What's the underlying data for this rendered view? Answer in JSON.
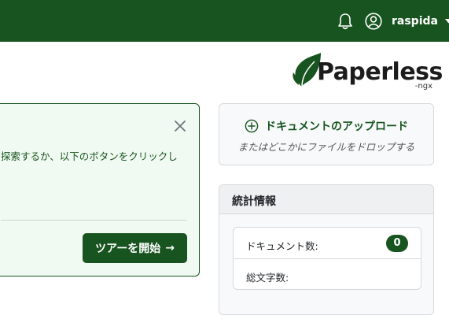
{
  "topbar": {
    "username": "raspida",
    "icons": {
      "notifications": "bell-icon",
      "user": "user-circle-icon",
      "menu": "caret-down-icon"
    }
  },
  "logo": {
    "name": "Paperless",
    "suffix": "-ngx"
  },
  "welcome": {
    "text": "探索するか、以下のボタンをクリックし",
    "tour_button": "ツアーを開始",
    "tour_arrow": "→"
  },
  "upload": {
    "title": "ドキュメントのアップロード",
    "hint": "またはどこかにファイルをドロップする"
  },
  "stats": {
    "title": "統計情報",
    "rows": [
      {
        "label": "ドキュメント数:",
        "value": "0"
      },
      {
        "label": "総文字数:"
      }
    ]
  },
  "colors": {
    "brand": "#17541f",
    "welcome_bg": "#f1faf2"
  }
}
